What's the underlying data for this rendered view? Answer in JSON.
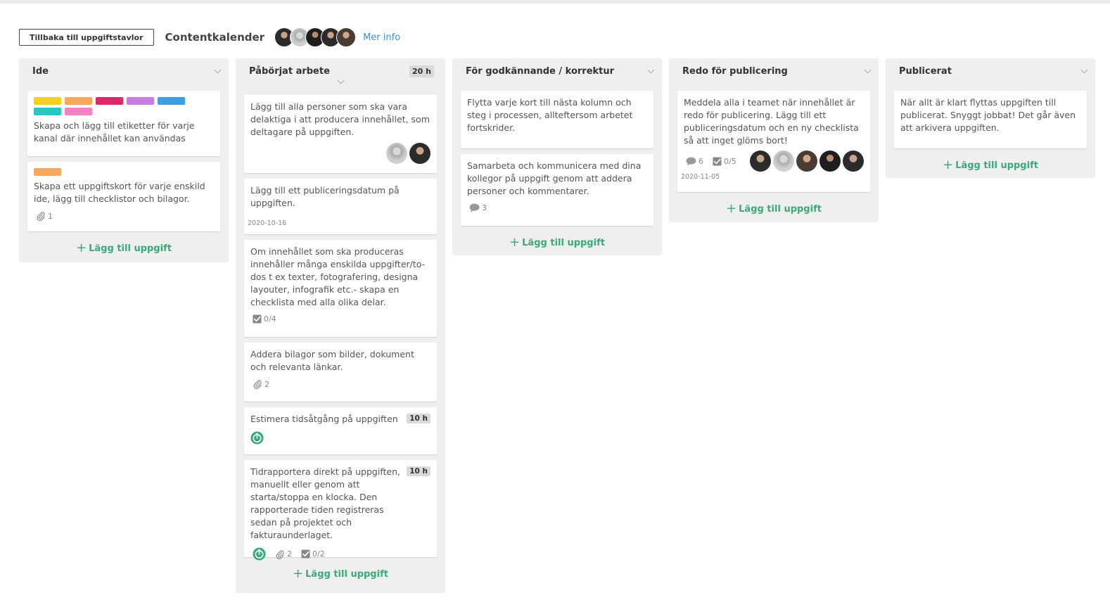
{
  "header": {
    "back_label": "Tillbaka till uppgiftstavlor",
    "board_title": "Contentkalender",
    "more_info": "Mer info"
  },
  "add_task_label": "Lägg till uppgift",
  "colors": {
    "accent_green": "#3aaa7a",
    "link_blue": "#3a8fd1",
    "label_yellow": "#f2d21b",
    "label_orange": "#f6a85e",
    "label_red": "#e3266a",
    "label_purple": "#c77ee0",
    "label_blue": "#3f9ee3",
    "label_teal": "#2ec4c4",
    "label_pink": "#f97fc4"
  },
  "columns": [
    {
      "title": "Ide",
      "cards": [
        {
          "text": "Skapa och lägg till etiketter för varje kanal där innehållet kan användas"
        },
        {
          "text": "Skapa ett uppgiftskort för varje enskild ide, lägg till checklistor och bilagor.",
          "attachments": "1"
        }
      ]
    },
    {
      "title": "Påbörjat arbete",
      "hours": "20 h",
      "cards": [
        {
          "text": "Lägg till alla personer som ska vara delaktiga i att producera innehållet, som deltagare på uppgiften."
        },
        {
          "text": "Lägg till ett publiceringsdatum på uppgiften.",
          "date": "2020-10-16"
        },
        {
          "text": "Om innehållet som ska produceras innehåller många enskilda uppgifter/to-dos t ex texter, fotografering, designa layouter, infografik etc.- skapa en checklista med alla olika delar.",
          "checklist": "0/4"
        },
        {
          "text": "Addera bilagor som bilder, dokument och relevanta länkar.",
          "attachments": "2"
        },
        {
          "text": "Estimera tidsåtgång på uppgiften",
          "hours": "10 h"
        },
        {
          "text": "Tidrapportera direkt på uppgiften, manuellt eller genom att starta/stoppa en klocka. Den rapporterade tiden registreras sedan på projektet och fakturaunderlaget.",
          "hours": "10 h",
          "attachments": "2",
          "checklist": "0/2"
        }
      ]
    },
    {
      "title": "För godkännande / korrektur",
      "cards": [
        {
          "text": "Flytta varje kort till nästa kolumn och steg i processen, allteftersom arbetet fortskrider."
        },
        {
          "text": "Samarbeta och kommunicera med dina kollegor på uppgift genom att addera personer och kommentarer.",
          "comments": "3"
        }
      ]
    },
    {
      "title": "Redo för publicering",
      "cards": [
        {
          "text": "Meddela alla i teamet när innehållet är redo för publicering. Lägg till ett publiceringsdatum och en ny checklista så att inget glöms bort!",
          "comments": "6",
          "checklist": "0/5",
          "date": "2020-11-05"
        }
      ]
    },
    {
      "title": "Publicerat",
      "cards": [
        {
          "text": "När allt är klart flyttas uppgiften till publicerat. Snyggt jobbat! Det går även att arkivera uppgiften."
        }
      ]
    }
  ]
}
